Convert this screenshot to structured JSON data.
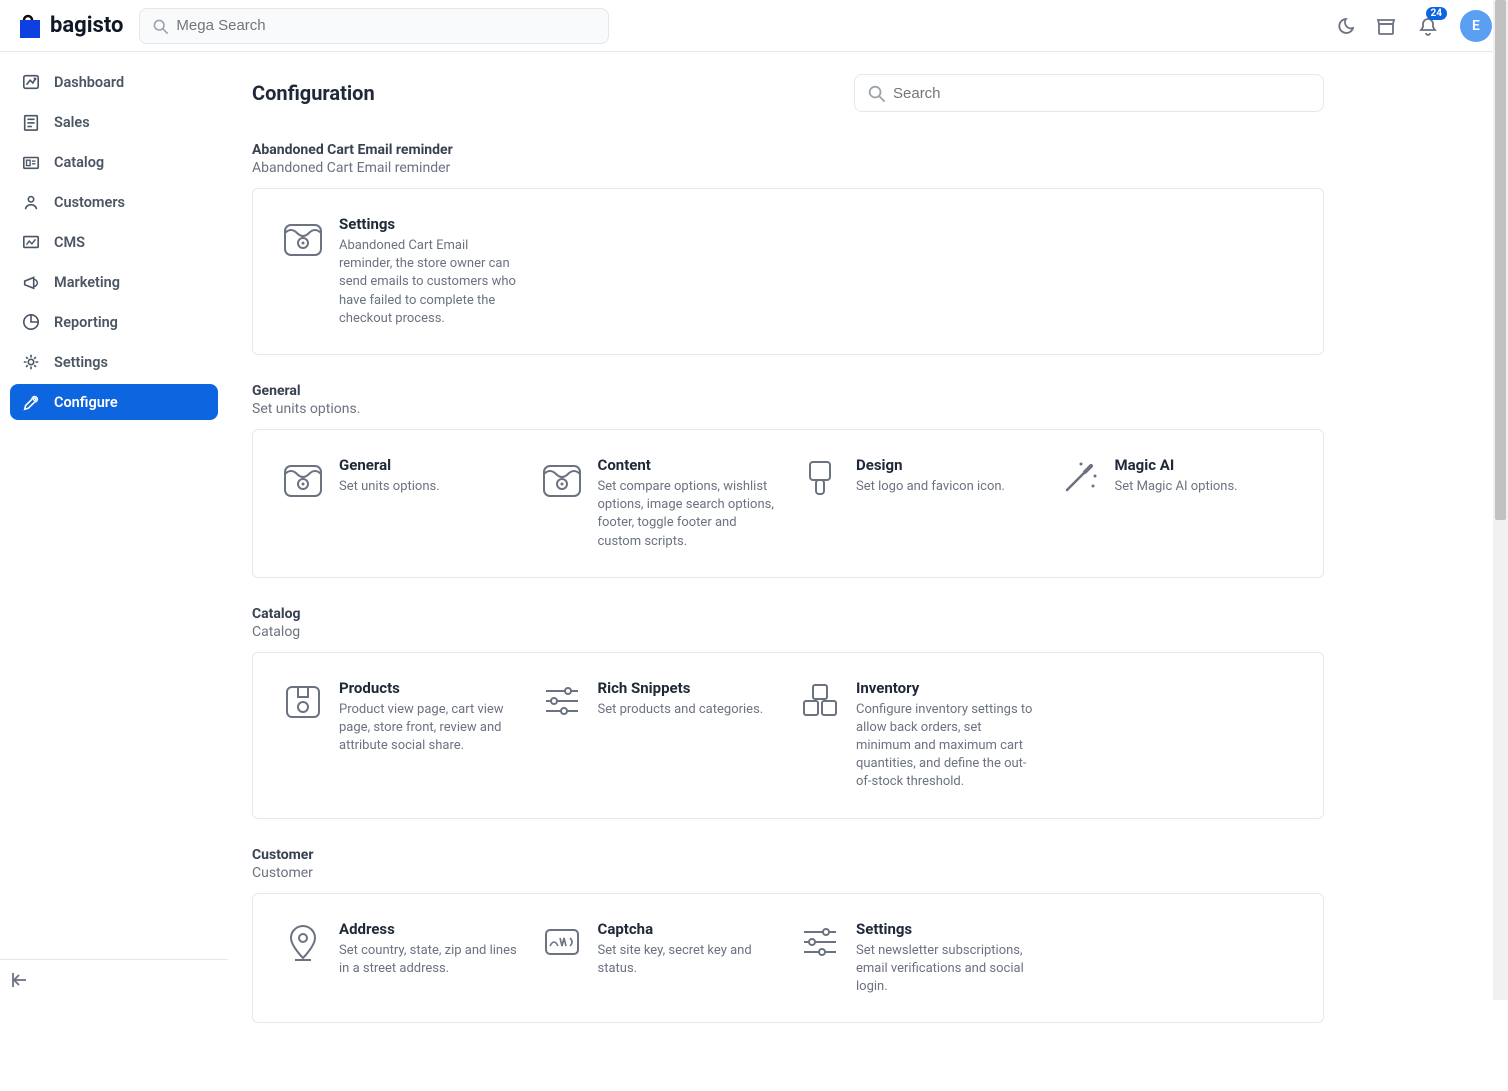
{
  "brand": {
    "name": "bagisto"
  },
  "mega_search": {
    "placeholder": "Mega Search"
  },
  "notifications": {
    "count": "24"
  },
  "avatar": {
    "initial": "E"
  },
  "sidebar": {
    "items": [
      {
        "label": "Dashboard"
      },
      {
        "label": "Sales"
      },
      {
        "label": "Catalog"
      },
      {
        "label": "Customers"
      },
      {
        "label": "CMS"
      },
      {
        "label": "Marketing"
      },
      {
        "label": "Reporting"
      },
      {
        "label": "Settings"
      },
      {
        "label": "Configure"
      }
    ]
  },
  "page": {
    "title": "Configuration",
    "search_placeholder": "Search"
  },
  "sections": [
    {
      "title": "Abandoned Cart Email reminder",
      "desc": "Abandoned Cart Email reminder",
      "items": [
        {
          "label": "Settings",
          "desc": "Abandoned Cart Email reminder, the store owner can send emails to customers who have failed to complete the checkout process.",
          "icon": "store-cog"
        }
      ]
    },
    {
      "title": "General",
      "desc": "Set units options.",
      "items": [
        {
          "label": "General",
          "desc": "Set units options.",
          "icon": "store-cog"
        },
        {
          "label": "Content",
          "desc": "Set compare options, wishlist options, image search options, footer, toggle footer and custom scripts.",
          "icon": "store-cog"
        },
        {
          "label": "Design",
          "desc": "Set logo and favicon icon.",
          "icon": "brush"
        },
        {
          "label": "Magic AI",
          "desc": "Set Magic AI options.",
          "icon": "wand"
        }
      ]
    },
    {
      "title": "Catalog",
      "desc": "Catalog",
      "items": [
        {
          "label": "Products",
          "desc": "Product view page, cart view page, store front, review and attribute social share.",
          "icon": "box-cog"
        },
        {
          "label": "Rich Snippets",
          "desc": "Set products and categories.",
          "icon": "sliders"
        },
        {
          "label": "Inventory",
          "desc": "Configure inventory settings to allow back orders, set minimum and maximum cart quantities, and define the out-of-stock threshold.",
          "icon": "boxes"
        }
      ]
    },
    {
      "title": "Customer",
      "desc": "Customer",
      "items": [
        {
          "label": "Address",
          "desc": "Set country, state, zip and lines in a street address.",
          "icon": "pin"
        },
        {
          "label": "Captcha",
          "desc": "Set site key, secret key and status.",
          "icon": "captcha"
        },
        {
          "label": "Settings",
          "desc": "Set newsletter subscriptions, email verifications and social login.",
          "icon": "sliders"
        }
      ]
    }
  ]
}
